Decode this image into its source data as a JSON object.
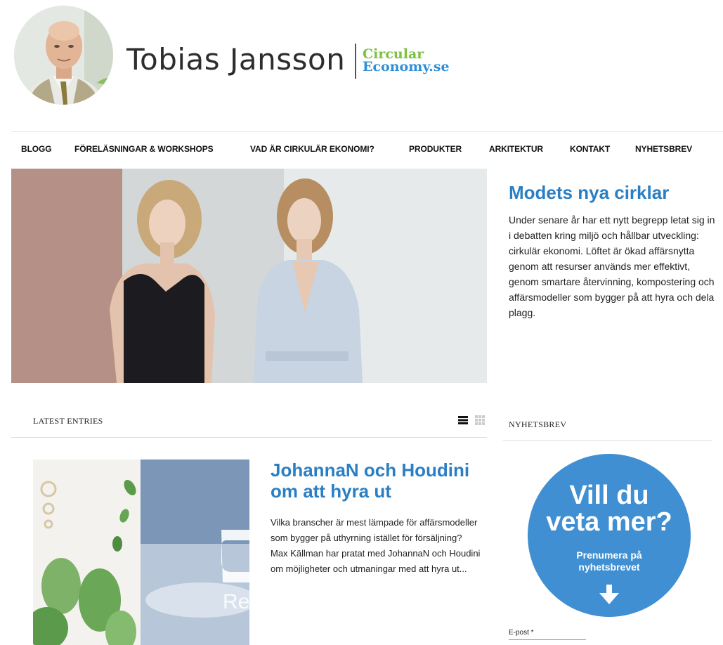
{
  "header": {
    "site_name": "Tobias Jansson",
    "brand_line1": "Circular",
    "brand_line2": "Economy.se"
  },
  "nav": {
    "items": [
      {
        "label": "BLOGG"
      },
      {
        "label": "FÖRELÄSNINGAR & WORKSHOPS"
      },
      {
        "label": "VAD ÄR CIRKULÄR EKONOMI?"
      },
      {
        "label": "PRODUKTER"
      },
      {
        "label": "ARKITEKTUR"
      },
      {
        "label": "KONTAKT"
      },
      {
        "label": "NYHETSBREV"
      }
    ]
  },
  "featured": {
    "title": "Modets nya cirklar",
    "text": "Under senare år har ett nytt begrepp letat sig in i debatten kring miljö och hållbar utveckling: cirkulär ekonomi. Löftet är ökad affärsnytta genom att resurser används mer effektivt, genom smartare återvinning, kompostering och affärsmodeller som bygger på att hyra och dela plagg."
  },
  "latest": {
    "label": "LATEST ENTRIES",
    "post": {
      "title": "JohannaN och Houdini om att hyra ut",
      "excerpt": "Vilka branscher är mest lämpade för affärsmodeller som bygger på uthyrning istället för försäljning? Max Källman har pratat med JohannaN och Houdini om möjligheter och utmaningar med att hyra ut...",
      "thumb_text": "Re"
    }
  },
  "sidebar": {
    "label": "NYHETSBREV",
    "circle_line1": "Vill du",
    "circle_line2": "veta mer?",
    "circle_sub1": "Prenumera på",
    "circle_sub2": "nyhetsbrevet",
    "email_label": "E-post *",
    "email_value": ""
  },
  "colors": {
    "accent_blue": "#2a7fc4",
    "brand_green": "#7cc242",
    "newsletter_blue": "#3f8fd2"
  }
}
